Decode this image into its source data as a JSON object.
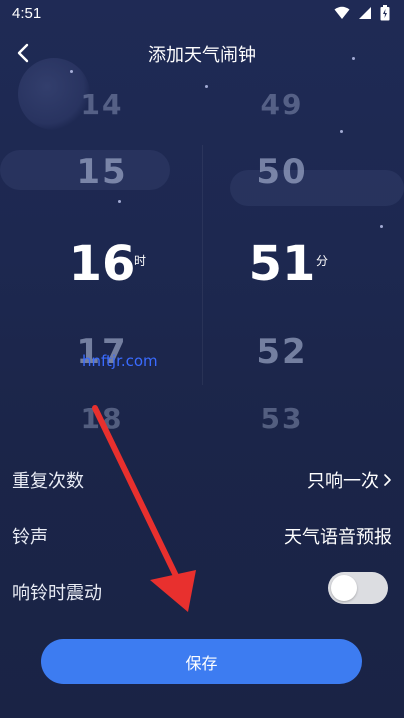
{
  "status": {
    "time": "4:51"
  },
  "nav": {
    "title": "添加天气闹钟"
  },
  "picker": {
    "hours": {
      "values": [
        "14",
        "15",
        "16",
        "17",
        "18"
      ],
      "selected": "16",
      "unit": "时"
    },
    "minutes": {
      "values": [
        "49",
        "50",
        "51",
        "52",
        "53"
      ],
      "selected": "51",
      "unit": "分"
    }
  },
  "watermark": "hnftjr.com",
  "settings": {
    "repeat": {
      "label": "重复次数",
      "value": "只响一次"
    },
    "ringtone": {
      "label": "铃声",
      "value": "天气语音预报"
    },
    "vibrate": {
      "label": "响铃时震动",
      "enabled": false
    }
  },
  "save_label": "保存",
  "colors": {
    "accent": "#3d7cf1",
    "annotation_arrow": "#e8302e"
  }
}
